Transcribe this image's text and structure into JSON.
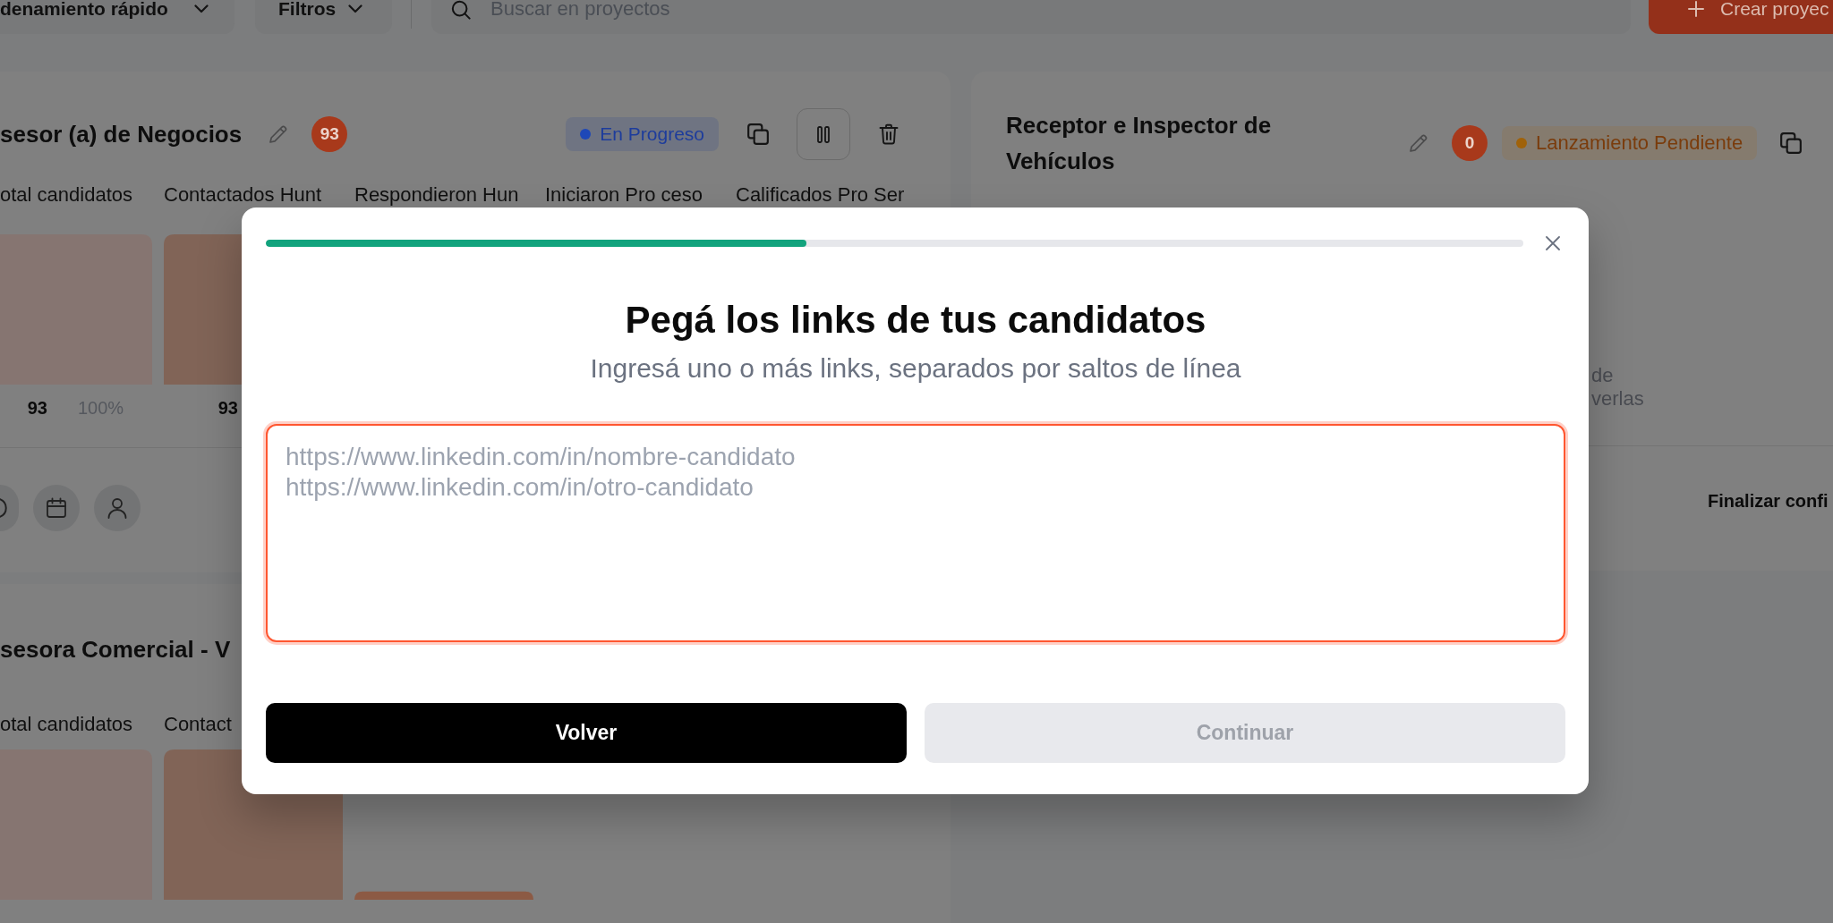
{
  "toolbar": {
    "sort_button": {
      "label": "denamiento rápido"
    },
    "filter_button": {
      "label": "Filtros"
    },
    "search": {
      "placeholder": "Buscar en proyectos"
    },
    "create_button": {
      "label": "Crear proyec"
    }
  },
  "projects": [
    {
      "title": "sesor (a) de Negocios",
      "count": "93",
      "status": {
        "kind": "in_progress",
        "label": "En Progreso"
      },
      "stages": [
        {
          "label": "otal candidatos",
          "count": "93",
          "percent": "100%"
        },
        {
          "label": "Contactados Hunt",
          "count": "93"
        },
        {
          "label": "Respondieron Hun"
        },
        {
          "label": "Iniciaron Pro ceso"
        },
        {
          "label": "Calificados Pro Ser"
        }
      ]
    },
    {
      "title": "Receptor e Inspector de Vehículos",
      "count": "0",
      "status": {
        "kind": "pending",
        "label": "Lanzamiento Pendiente"
      },
      "description_fragment": "de\nverlas",
      "finish_button": {
        "label": "Finalizar confi"
      }
    },
    {
      "title": "sesora Comercial - V",
      "stages": [
        {
          "label": "otal candidatos"
        },
        {
          "label": "Contact"
        }
      ]
    }
  ],
  "modal": {
    "progress": {
      "level": 0.43
    },
    "title": "Pegá los links de tus candidatos",
    "subtitle": "Ingresá uno o más links, separados por saltos de línea",
    "links_field": {
      "placeholder": "https://www.linkedin.com/in/nombre-candidato\nhttps://www.linkedin.com/in/otro-candidato",
      "focused": true
    },
    "buttons": [
      {
        "kind": "back",
        "label": "Volver",
        "disabled": false
      },
      {
        "kind": "continue",
        "label": "Continuar",
        "disabled": true
      }
    ]
  }
}
